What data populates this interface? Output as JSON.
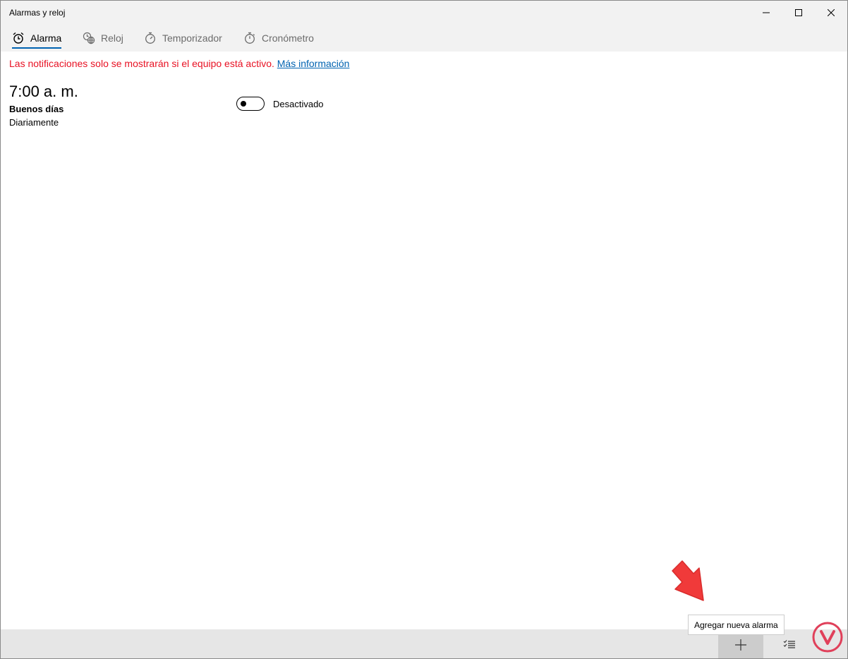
{
  "window": {
    "title": "Alarmas y reloj",
    "controls": [
      "minimize-icon",
      "maximize-icon",
      "close-icon"
    ]
  },
  "tabs": [
    {
      "label": "Alarma",
      "icon": "alarm-clock-icon",
      "active": true
    },
    {
      "label": "Reloj",
      "icon": "world-clock-icon",
      "active": false
    },
    {
      "label": "Temporizador",
      "icon": "timer-icon",
      "active": false
    },
    {
      "label": "Cronómetro",
      "icon": "stopwatch-icon",
      "active": false
    }
  ],
  "notice": {
    "text": "Las notificaciones solo se mostrarán si el equipo está activo.",
    "link": "Más información"
  },
  "alarms": [
    {
      "time": "7:00 a. m.",
      "name": "Buenos días",
      "repeat": "Diariamente",
      "enabled": false,
      "status": "Desactivado"
    }
  ],
  "commandbar": {
    "add_tooltip": "Agregar nueva alarma",
    "buttons": [
      "add-icon",
      "select-alarms-icon"
    ]
  },
  "colors": {
    "accent": "#0063b1",
    "notice": "#e81123",
    "chrome": "#f2f2f2",
    "commandbar": "#e6e6e6",
    "arrow": "#f03a3a",
    "watermark": "#e0405a"
  }
}
